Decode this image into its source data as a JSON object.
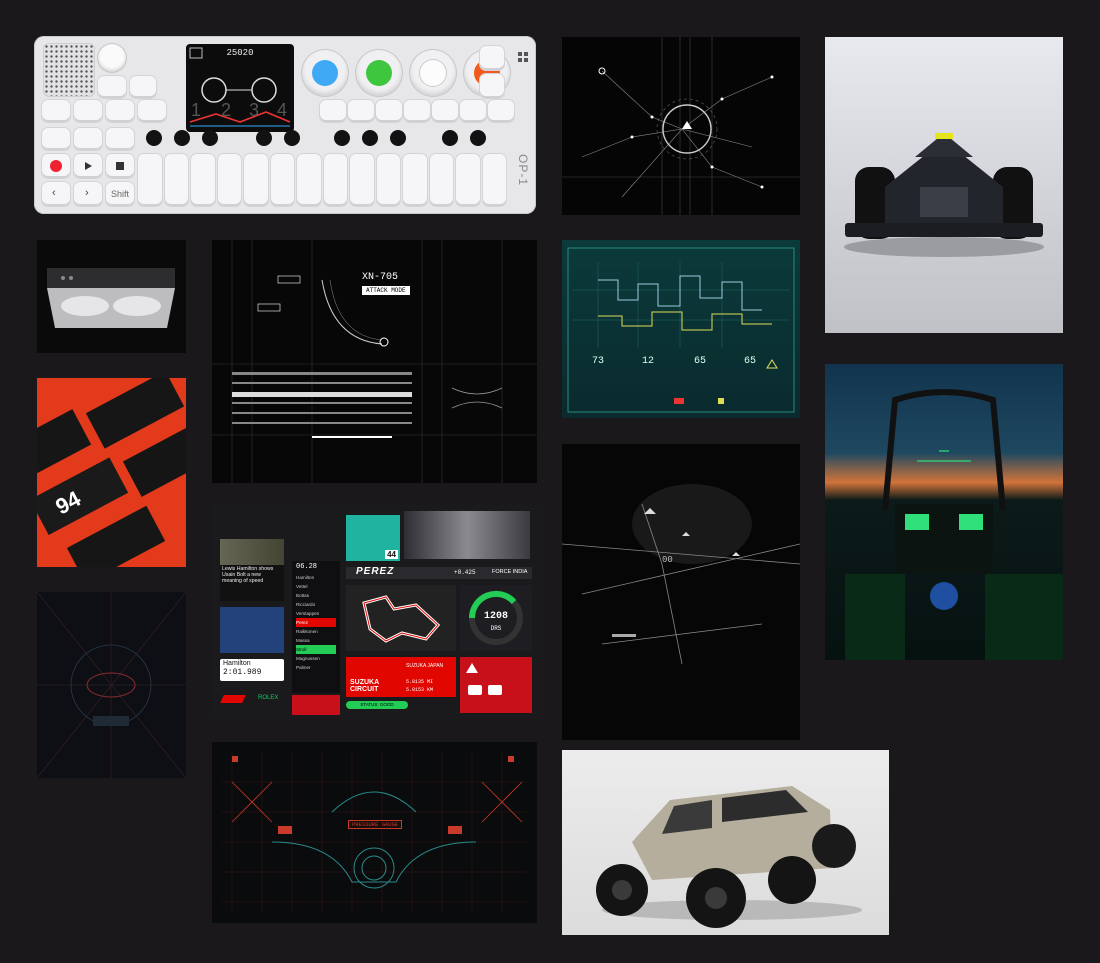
{
  "colors": {
    "background": "#1b181b",
    "synth_body": "#e7e7ea",
    "knob_blue": "#3fa9f5",
    "knob_green": "#3ec63e",
    "knob_white": "#f2f2f2",
    "knob_orange": "#f05a1a",
    "f1_red": "#e10600",
    "hud_green": "#28e07a",
    "hud_red": "#c83a2a"
  },
  "synth": {
    "brand": "OP-1",
    "screen_time": "25020",
    "number_keys": [
      "1",
      "2",
      "3",
      "4"
    ],
    "shift_label": "Shift",
    "icons": [
      "speaker-grille-icon",
      "volume-knob-icon",
      "metronome-icon",
      "record-icon",
      "play-icon",
      "stop-icon",
      "arrow-left-icon",
      "arrow-right-icon",
      "microphone-icon"
    ]
  },
  "hud_blueprint": {
    "title": "XN-705",
    "tag": "ATTACK MODE"
  },
  "f1_board": {
    "headline": "Lewis Hamilton shows Usain Bolt a new meaning of speed",
    "driver_name": "Hamilton",
    "lap_time": "2:01.989",
    "sponsor": "ROLEX",
    "timing_header": "06.28",
    "standings": [
      "Hamilton",
      "Vettel",
      "Bottas",
      "Ricciardo",
      "Verstappen",
      "Perez",
      "Raikkonen",
      "Massa",
      "Stroll",
      "Magnussen",
      "Palmer"
    ],
    "driver_number": "44",
    "banner_driver": "PEREZ",
    "banner_team": "FORCE INDIA",
    "banner_gap": "+0.425",
    "circuit_name": "SUZUKA CIRCUIT",
    "circuit_location": "SUZUKA JAPAN",
    "circuit_stats": [
      "5.8135 MI",
      "5.8153 KM"
    ],
    "speed": "1208",
    "gear_label": "DRS",
    "status_pill": "STATUS: GOOD"
  },
  "telemetry": {
    "readouts": [
      "73",
      "12",
      "65",
      "65"
    ]
  },
  "canopy": {
    "title": "PRESSURE GAUGE"
  }
}
